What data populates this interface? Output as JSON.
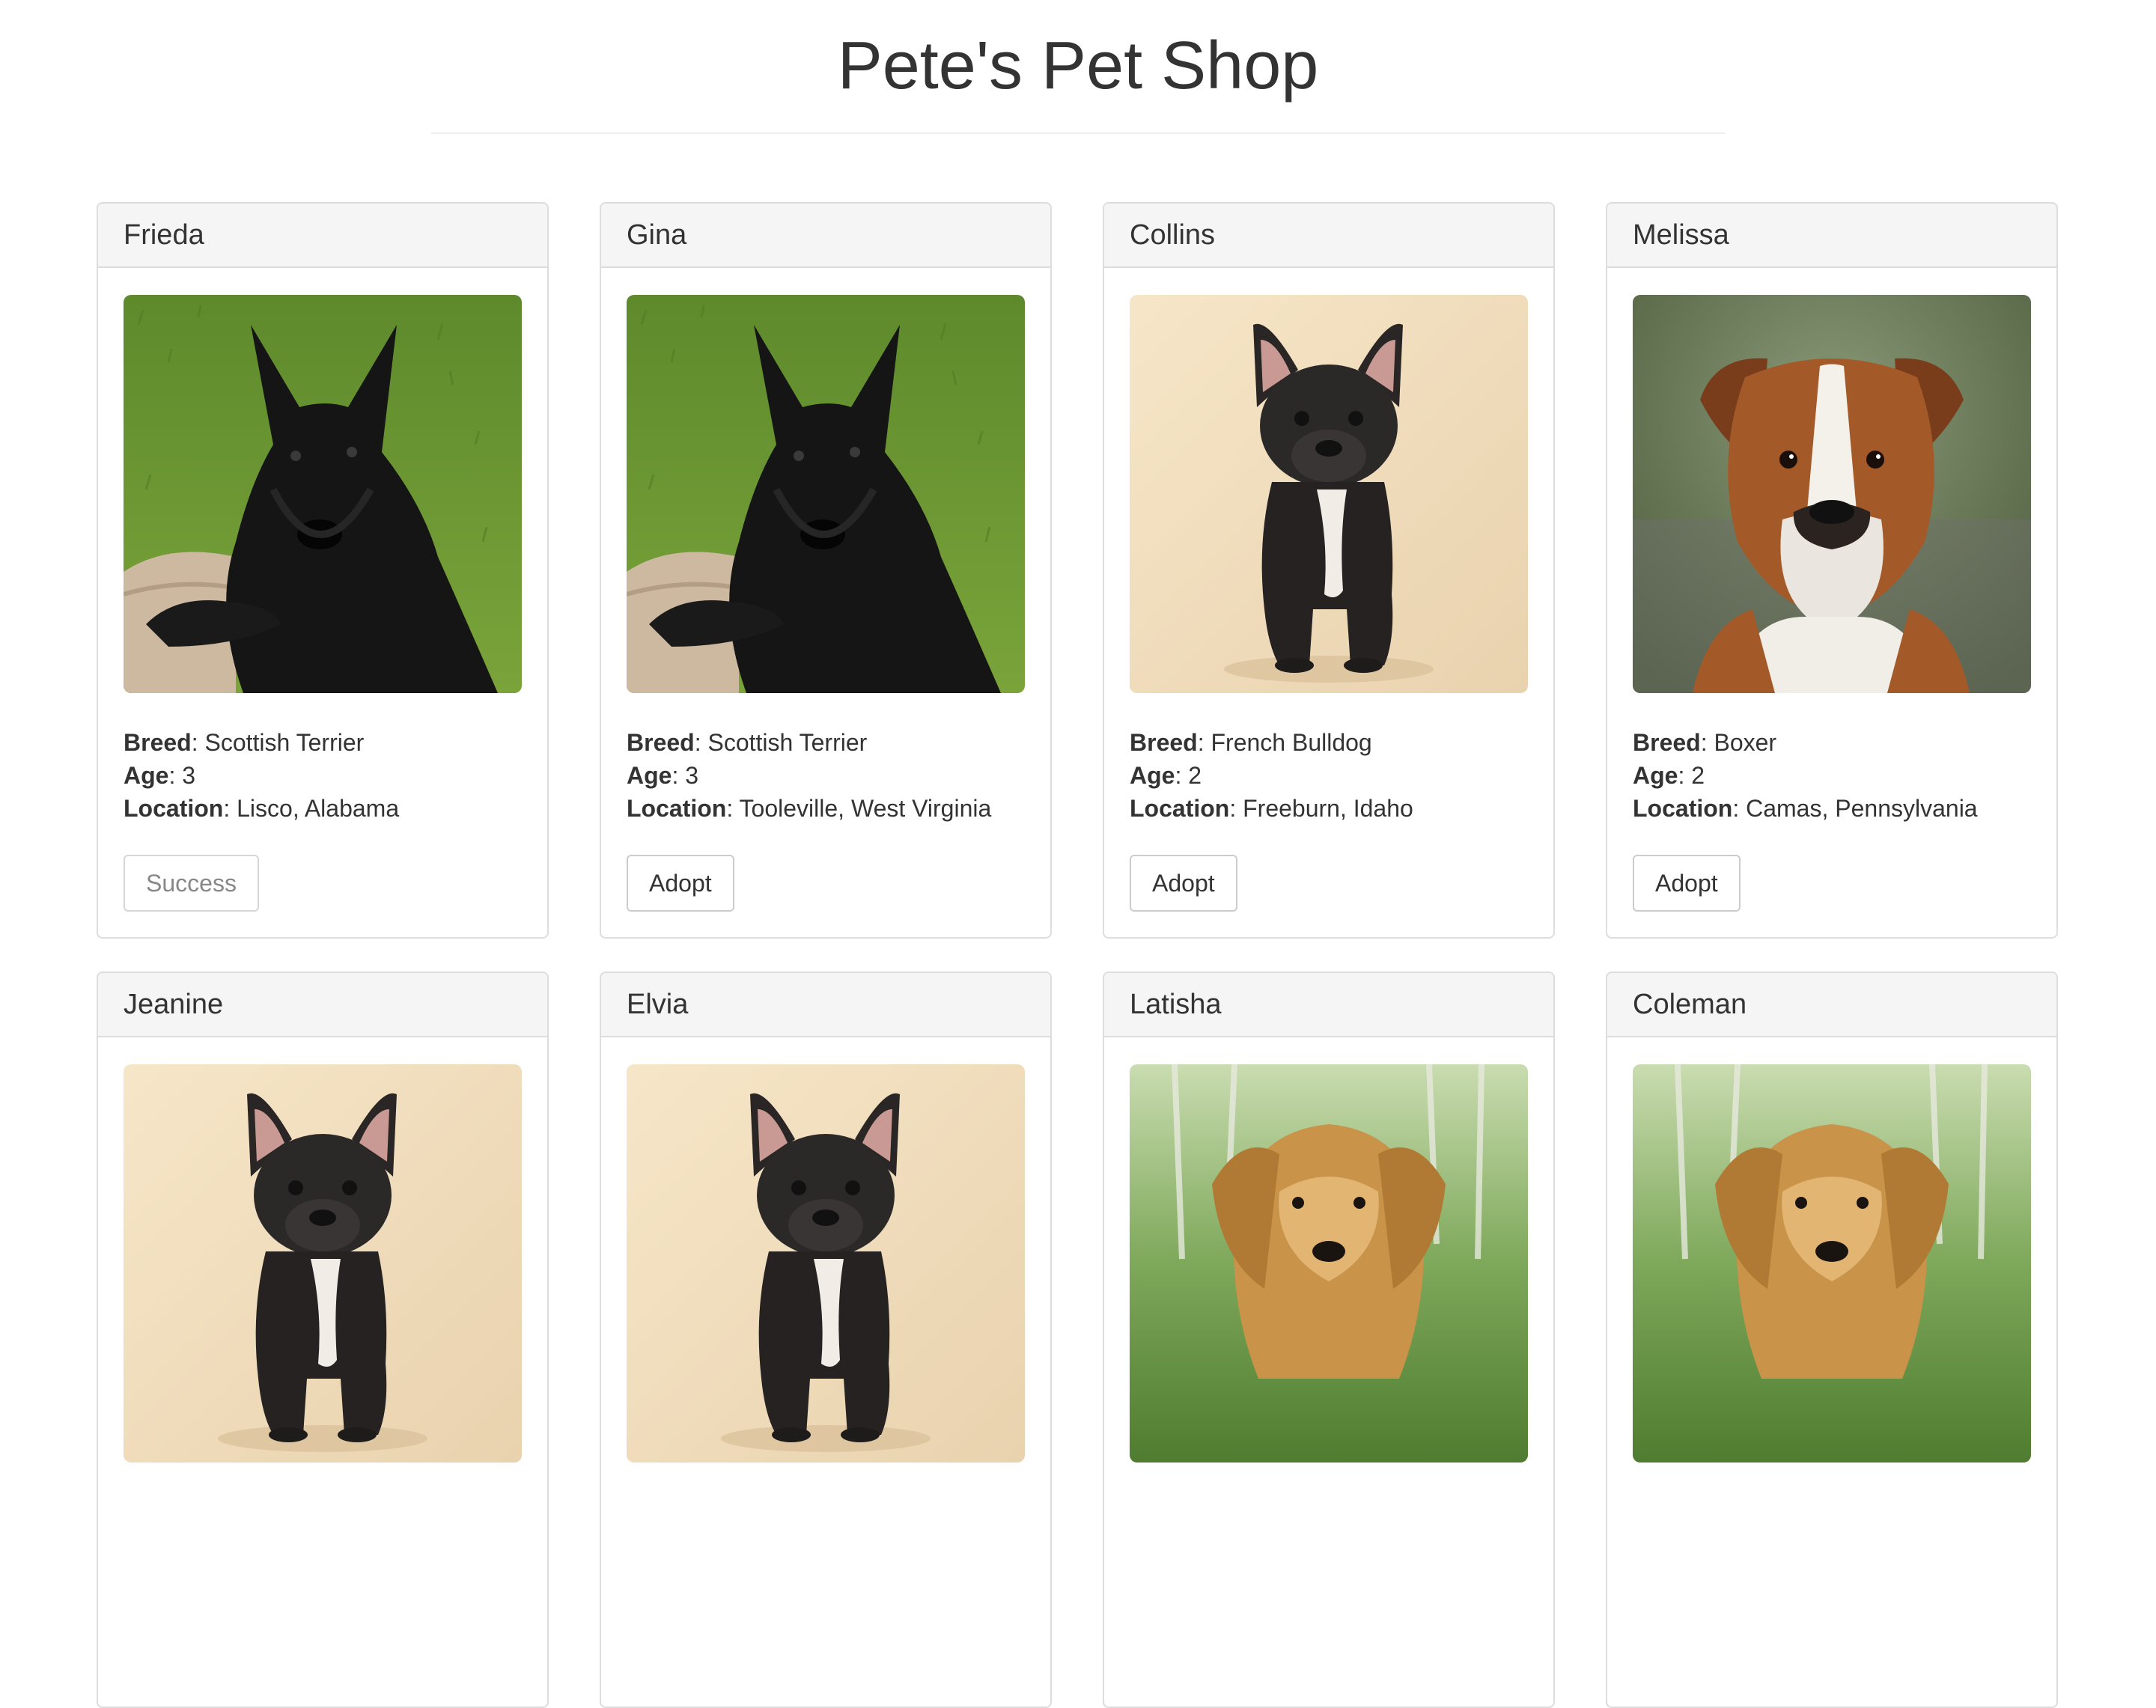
{
  "page": {
    "title": "Pete's Pet Shop"
  },
  "labels": {
    "breed": "Breed",
    "age": "Age",
    "location": "Location"
  },
  "pets": [
    {
      "name": "Frieda",
      "breed": "Scottish Terrier",
      "age": "3",
      "location": "Lisco, Alabama",
      "button": "Success",
      "photo": "scottish-terrier-photo"
    },
    {
      "name": "Gina",
      "breed": "Scottish Terrier",
      "age": "3",
      "location": "Tooleville, West Virginia",
      "button": "Adopt",
      "photo": "scottish-terrier-photo"
    },
    {
      "name": "Collins",
      "breed": "French Bulldog",
      "age": "2",
      "location": "Freeburn, Idaho",
      "button": "Adopt",
      "photo": "french-bulldog-photo"
    },
    {
      "name": "Melissa",
      "breed": "Boxer",
      "age": "2",
      "location": "Camas, Pennsylvania",
      "button": "Adopt",
      "photo": "boxer-photo"
    },
    {
      "name": "Jeanine",
      "photo": "french-bulldog-photo"
    },
    {
      "name": "Elvia",
      "photo": "french-bulldog-photo"
    },
    {
      "name": "Latisha",
      "photo": "golden-retriever-photo"
    },
    {
      "name": "Coleman",
      "photo": "golden-retriever-photo"
    }
  ]
}
